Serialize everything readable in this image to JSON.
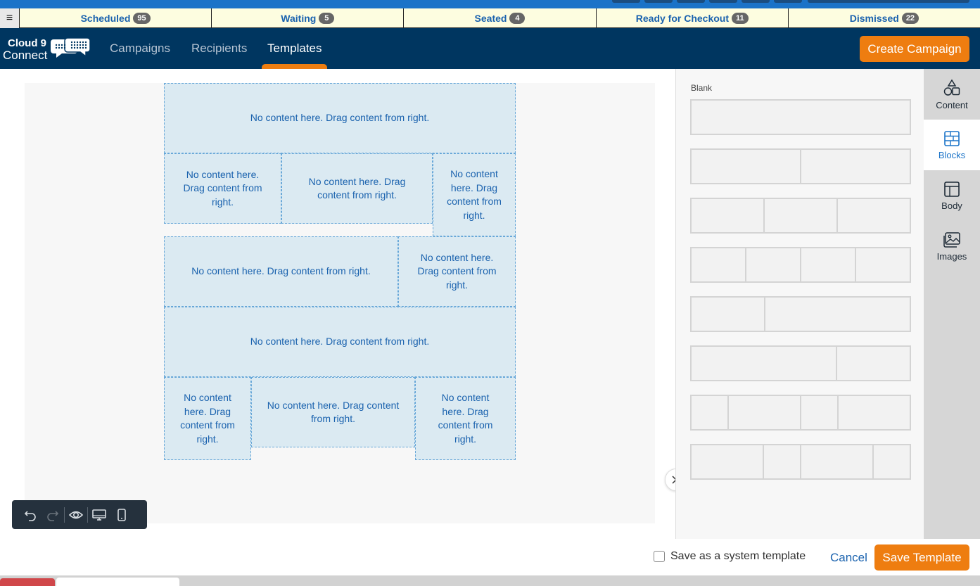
{
  "status_bar": {
    "menu_glyph": "≡",
    "items": [
      {
        "label": "Scheduled",
        "count": "95"
      },
      {
        "label": "Waiting",
        "count": "5"
      },
      {
        "label": "Seated",
        "count": "4"
      },
      {
        "label": "Ready for Checkout",
        "count": "11"
      },
      {
        "label": "Dismissed",
        "count": "22"
      }
    ]
  },
  "navbar": {
    "logo_line1": "Cloud 9",
    "logo_line2": "Connect",
    "links": [
      "Campaigns",
      "Recipients",
      "Templates"
    ],
    "active_link": "Templates",
    "create_label": "Create Campaign"
  },
  "editor": {
    "placeholder": "No content here. Drag content from right."
  },
  "panel": {
    "section_label": "Blank",
    "tabs": [
      {
        "label": "Content",
        "icon": "shapes-icon"
      },
      {
        "label": "Blocks",
        "icon": "blocks-icon"
      },
      {
        "label": "Body",
        "icon": "layout-icon"
      },
      {
        "label": "Images",
        "icon": "image-icon"
      }
    ],
    "active_tab": "Blocks"
  },
  "footer": {
    "system_template_label": "Save as a system template",
    "cancel_label": "Cancel",
    "save_label": "Save Template"
  },
  "colors": {
    "navbar": "#003660",
    "accent": "#ee7d10",
    "link": "#1a62ae",
    "slot_bg": "#dbeaf2"
  }
}
